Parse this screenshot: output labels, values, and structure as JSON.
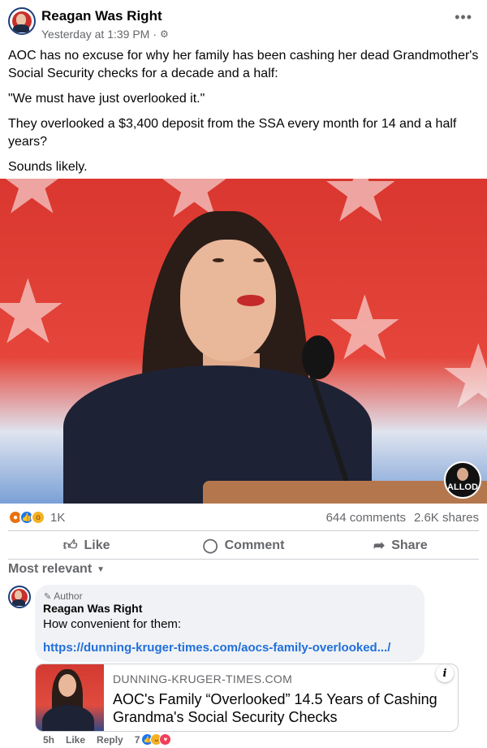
{
  "post": {
    "author": "Reagan Was Right",
    "timestamp": "Yesterday at 1:39 PM",
    "separator": "·",
    "audience_icon": "gear-icon",
    "more_icon": "more-dots-icon",
    "paragraphs": [
      "AOC has no excuse for why her family has been cashing her dead Grandmother's Social Security checks for a decade and a half:",
      "\"We must have just overlooked it.\"",
      "They overlooked a $3,400 deposit from the SSA every month for 14 and a half years?",
      "Sounds likely."
    ],
    "image_badge": "ALLOD"
  },
  "stats": {
    "reaction_icons": [
      "angry",
      "like",
      "wow"
    ],
    "reaction_count": "1K",
    "comments": "644 comments",
    "shares": "2.6K shares"
  },
  "actions": {
    "like": "Like",
    "comment": "Comment",
    "share": "Share"
  },
  "comments_sort": "Most relevant",
  "comment": {
    "author_tag": "Author",
    "name": "Reagan Was Right",
    "text": "How convenient for them:",
    "link": "https://dunning-kruger-times.com/aocs-family-overlooked.../",
    "preview": {
      "domain": "DUNNING-KRUGER-TIMES.COM",
      "title": "AOC's Family “Overlooked” 14.5 Years of Cashing Grandma's Social Security Checks"
    },
    "age": "5h",
    "like": "Like",
    "reply": "Reply",
    "reaction_count": "7"
  },
  "colors": {
    "link_blue": "#216fdb",
    "secondary_text": "#65676b",
    "like_blue": "#1877f2",
    "bubble_bg": "#f0f2f5"
  }
}
